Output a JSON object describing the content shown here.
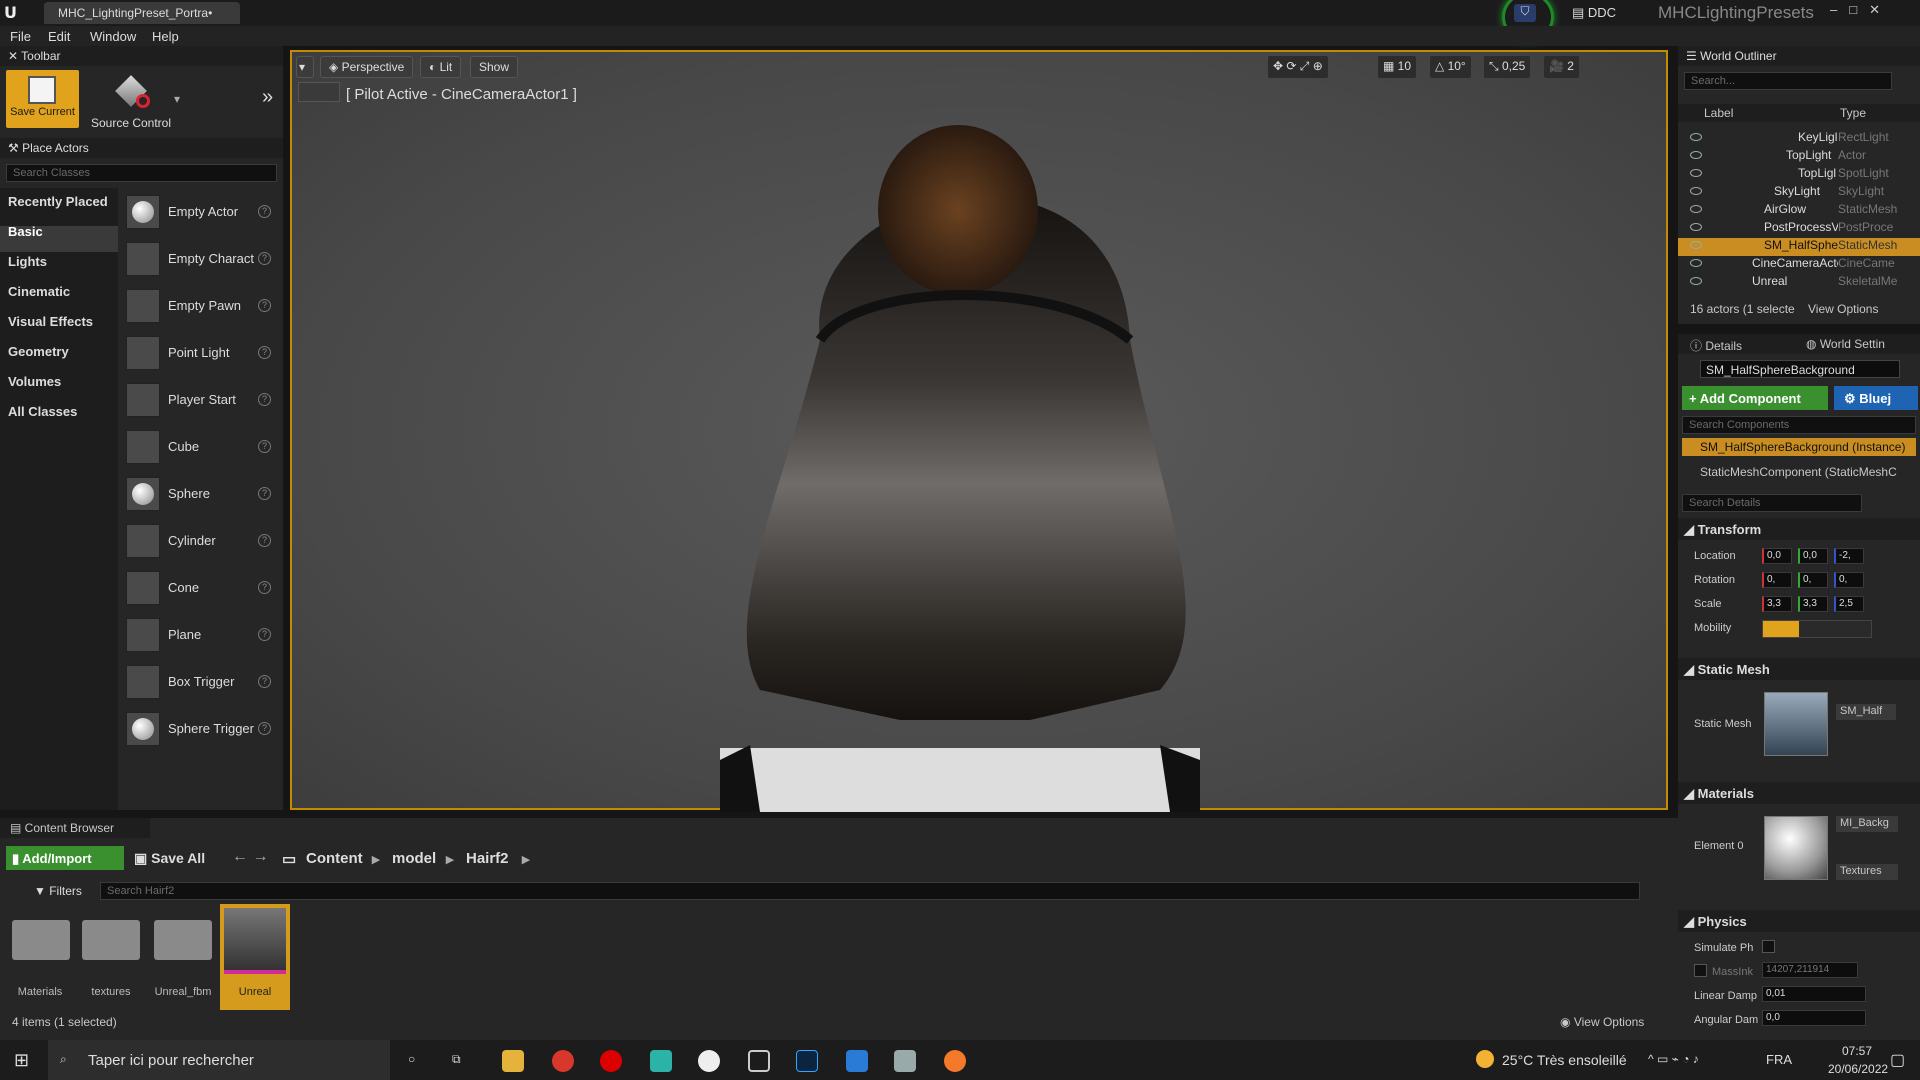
{
  "window": {
    "doc_tab": "MHC_LightingPreset_Portra•",
    "ddc": "DDC",
    "project": "MHCLightingPresets"
  },
  "menu": [
    "File",
    "Edit",
    "Window",
    "Help"
  ],
  "toolbar": {
    "title": "Toolbar",
    "save": "Save Current",
    "source": "Source Control"
  },
  "place_actors": {
    "title": "Place Actors",
    "search_placeholder": "Search Classes",
    "categories": [
      "Recently Placed",
      "Basic",
      "Lights",
      "Cinematic",
      "Visual Effects",
      "Geometry",
      "Volumes",
      "All Classes"
    ],
    "actors": [
      "Empty Actor",
      "Empty Charact",
      "Empty Pawn",
      "Point Light",
      "Player Start",
      "Cube",
      "Sphere",
      "Cylinder",
      "Cone",
      "Plane",
      "Box Trigger",
      "Sphere Trigger"
    ]
  },
  "viewport": {
    "perspective": "Perspective",
    "lit": "Lit",
    "show": "Show",
    "pilot": "[ Pilot Active - CineCameraActor1 ]",
    "grid": "10",
    "rot": "10°",
    "scale": "0,25",
    "cam": "2"
  },
  "outliner": {
    "title": "World Outliner",
    "search_placeholder": "Search...",
    "col_label": "Label",
    "col_type": "Type",
    "rows": [
      {
        "name": "KeyLigl",
        "type": "RectLight"
      },
      {
        "name": "TopLight",
        "type": "Actor"
      },
      {
        "name": "TopLigl",
        "type": "SpotLight"
      },
      {
        "name": "SkyLight",
        "type": "SkyLight"
      },
      {
        "name": "AirGlow",
        "type": "StaticMesh"
      },
      {
        "name": "PostProcessV",
        "type": "PostProce"
      },
      {
        "name": "SM_HalfSpher",
        "type": "StaticMesh"
      },
      {
        "name": "CineCameraActo",
        "type": "CineCame"
      },
      {
        "name": "Unreal",
        "type": "SkeletalMe"
      }
    ],
    "status": "16 actors (1 selecte",
    "view_options": "View Options"
  },
  "details": {
    "tab": "Details",
    "tab2": "World Settin",
    "actor_name": "SM_HalfSphereBackground",
    "add_component": "+ Add Component",
    "blueprint": "Bluej",
    "search_components": "Search Components",
    "instance": "SM_HalfSphereBackground (Instance)",
    "component": "StaticMeshComponent (StaticMeshC",
    "search_details": "Search Details",
    "transform": "Transform",
    "location": "Location",
    "rotation": "Rotation",
    "scale": "Scale",
    "mobility": "Mobility",
    "loc": [
      "0,0",
      "0,0",
      "-2,"
    ],
    "rot": [
      "0,",
      "0,",
      "0,"
    ],
    "scl": [
      "3,3",
      "3,3",
      "2,5"
    ],
    "static_mesh_section": "Static Mesh",
    "static_mesh": "Static Mesh",
    "mesh_value": "SM_Half",
    "materials_section": "Materials",
    "element0": "Element 0",
    "material_value": "MI_Backg",
    "textures": "Textures",
    "physics": "Physics",
    "simulate": "Simulate Ph",
    "mass_label": "MassInk",
    "mass": "14207,211914",
    "linear_label": "Linear Damp",
    "linear": "0,01",
    "angular_label": "Angular Dam",
    "angular": "0,0"
  },
  "content_browser": {
    "title": "Content Browser",
    "add_import": "Add/Import",
    "save_all": "Save All",
    "crumbs": [
      "Content",
      "model",
      "Hairf2"
    ],
    "filters": "Filters",
    "search_placeholder": "Search Hairf2",
    "items": [
      "Materials",
      "textures",
      "Unreal_fbm",
      "Unreal"
    ],
    "status": "4 items (1 selected)",
    "view_options": "View Options"
  },
  "taskbar": {
    "search": "Taper ici pour rechercher",
    "weather": "25°C  Très ensoleillé",
    "lang": "FRA",
    "time": "07:57",
    "date": "20/06/2022"
  }
}
